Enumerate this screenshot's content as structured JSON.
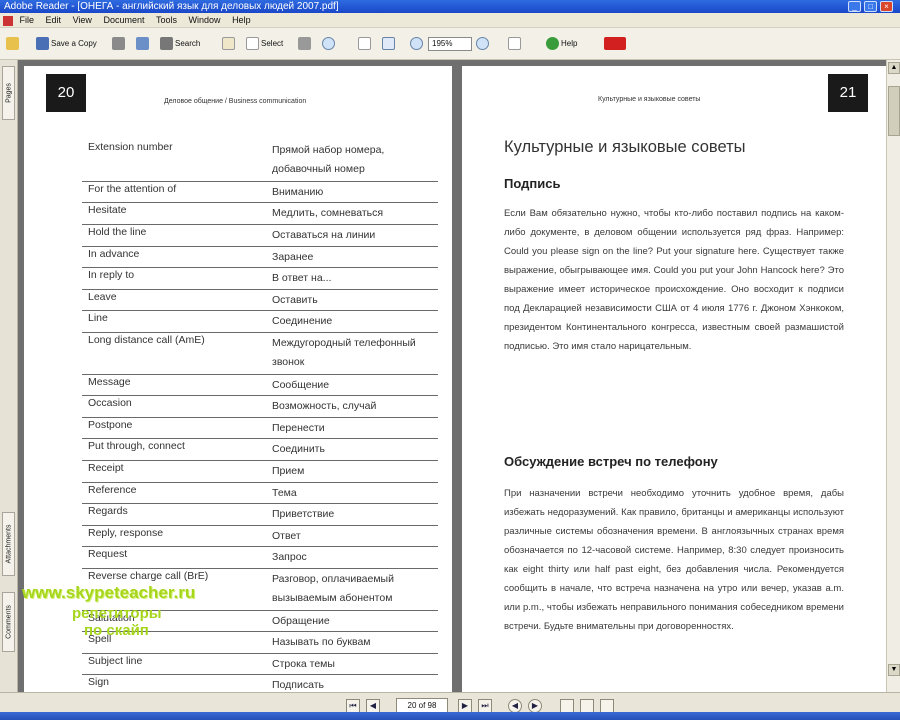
{
  "window": {
    "title": "Adobe Reader - [ОНЕГА - английский язык для деловых людей 2007.pdf]"
  },
  "menu": {
    "items": [
      "File",
      "Edit",
      "View",
      "Document",
      "Tools",
      "Window",
      "Help"
    ]
  },
  "toolbar": {
    "save_label": "Save a Copy",
    "search_label": "Search",
    "select_label": "Select",
    "zoom_value": "195%",
    "help_label": "Help"
  },
  "nav_tabs": {
    "pages": "Pages",
    "attachments": "Attachments",
    "comments": "Comments"
  },
  "left_page": {
    "number": "20",
    "running_head": "Деловое общение / Business communication",
    "rows": [
      {
        "en": "Extension number",
        "ru": "Прямой набор номера, добавочный номер"
      },
      {
        "en": "For the attention of",
        "ru": "Вниманию"
      },
      {
        "en": "Hesitate",
        "ru": "Медлить, сомневаться"
      },
      {
        "en": "Hold the line",
        "ru": "Оставаться на линии"
      },
      {
        "en": "In advance",
        "ru": "Заранее"
      },
      {
        "en": "In reply to",
        "ru": "В ответ на..."
      },
      {
        "en": "Leave",
        "ru": "Оставить"
      },
      {
        "en": "Line",
        "ru": "Соединение"
      },
      {
        "en": "Long distance call (AmE)",
        "ru": "Междугородный телефонный звонок"
      },
      {
        "en": "Message",
        "ru": "Сообщение"
      },
      {
        "en": "Occasion",
        "ru": "Возможность, случай"
      },
      {
        "en": "Postpone",
        "ru": "Перенести"
      },
      {
        "en": "Put through, connect",
        "ru": "Соединить"
      },
      {
        "en": "Receipt",
        "ru": "Прием"
      },
      {
        "en": "Reference",
        "ru": "Тема"
      },
      {
        "en": "Regards",
        "ru": "Приветствие"
      },
      {
        "en": "Reply, response",
        "ru": "Ответ"
      },
      {
        "en": "Request",
        "ru": "Запрос"
      },
      {
        "en": "Reverse charge call (BrE)",
        "ru": "Разговор, оплачиваемый вызываемым абонентом"
      },
      {
        "en": "Salutation",
        "ru": "Обращение"
      },
      {
        "en": "Spell",
        "ru": "Называть по буквам"
      },
      {
        "en": "Subject line",
        "ru": "Строка темы"
      },
      {
        "en": "Sign",
        "ru": "Подписать"
      }
    ]
  },
  "watermark": {
    "line1": "www.skypeteacher.ru",
    "line2": "репетиторы",
    "line3": "по скайп"
  },
  "right_page": {
    "number": "21",
    "running_head": "Культурные и языковые советы",
    "heading": "Культурные и языковые советы",
    "sub1": "Подпись",
    "para1": "Если Вам обязательно нужно, чтобы кто-либо поставил подпись на каком-либо документе, в деловом общении используется ряд фраз. Например: Could you please sign on the line? Put your signature here. Существует также выражение, обыгрывающее имя. Could you put your John Hancock here? Это выражение имеет историческое происхождение. Оно восходит к подписи под Декларацией независимости США от 4 июля 1776 г. Джоном Хэнкоком, президентом Континентального конгресса, известным своей размашистой подписью. Это имя стало нарицательным.",
    "sub2": "Обсуждение встреч по телефону",
    "para2": "При назначении встречи необходимо уточнить удобное время, дабы избежать недоразумений. Как правило, британцы и американцы используют различные системы обозначения времени. В англоязычных странах время обозначается по 12-часовой системе. Например, 8:30 следует произносить как eight thirty или half past eight, без добавления числа. Рекомендуется сообщить в начале, что встреча назначена на утро или вечер, указав a.m. или p.m., чтобы избежать неправильного понимания собеседником времени встречи. Будьте внимательны при договоренностях."
  },
  "statusbar": {
    "page_field": "20 of 98"
  }
}
